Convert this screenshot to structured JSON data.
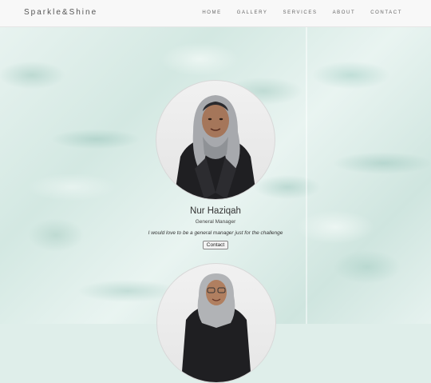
{
  "brand": "Sparkle&Shine",
  "nav": [
    "HOME",
    "GALLERY",
    "SERVICES",
    "ABOUT",
    "CONTACT"
  ],
  "profile": {
    "name": "Nur Haziqah",
    "role": "General Manager",
    "quote": "I would love to be a general manager just for the challenge",
    "button": "Contact"
  }
}
